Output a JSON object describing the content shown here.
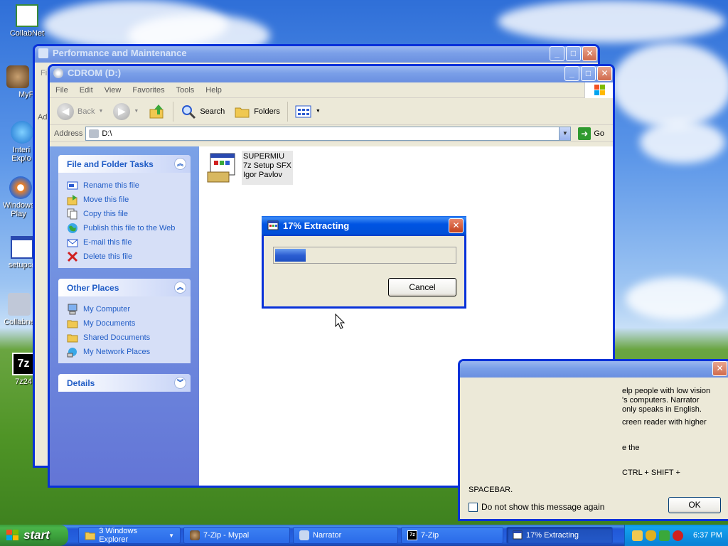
{
  "desktop": {
    "icons": [
      {
        "label": "CollabNet"
      },
      {
        "label": "MyP"
      },
      {
        "label": "Interi Explo"
      },
      {
        "label": "Windows Play"
      },
      {
        "label": "setupce"
      },
      {
        "label": "Collabne"
      },
      {
        "label": "7z24"
      }
    ]
  },
  "back_window": {
    "title": "Performance and Maintenance",
    "menu_fragment": "Fi",
    "addr_fragment": "Ad"
  },
  "explorer": {
    "title": "CDROM (D:)",
    "menu": [
      "File",
      "Edit",
      "View",
      "Favorites",
      "Tools",
      "Help"
    ],
    "toolbar": {
      "back": "Back",
      "search": "Search",
      "folders": "Folders"
    },
    "address_label": "Address",
    "address_value": "D:\\",
    "go_label": "Go",
    "file_tasks": {
      "title": "File and Folder Tasks",
      "items": [
        "Rename this file",
        "Move this file",
        "Copy this file",
        "Publish this file to the Web",
        "E-mail this file",
        "Delete this file"
      ]
    },
    "other_places": {
      "title": "Other Places",
      "items": [
        "My Computer",
        "My Documents",
        "Shared Documents",
        "My Network Places"
      ]
    },
    "details": {
      "title": "Details"
    },
    "file": {
      "name": "SUPERMIU",
      "type": "7z Setup SFX",
      "author": "Igor Pavlov"
    }
  },
  "progress_dialog": {
    "title": "17% Extracting",
    "progress_fraction": 0.17,
    "cancel_label": "Cancel"
  },
  "narrator": {
    "lines": [
      "elp people with low vision",
      "'s computers. Narrator",
      "only speaks in English.",
      "creen reader with higher",
      "e the",
      "CTRL + SHIFT +",
      "SPACEBAR."
    ],
    "checkbox_label": "Do not show this message again",
    "ok_label": "OK"
  },
  "taskbar": {
    "start_label": "start",
    "items": [
      {
        "label": "3 Windows Explorer"
      },
      {
        "label": "7-Zip - Mypal"
      },
      {
        "label": "Narrator"
      },
      {
        "label": "7-Zip"
      },
      {
        "label": "17% Extracting"
      }
    ],
    "clock": "6:37 PM"
  }
}
